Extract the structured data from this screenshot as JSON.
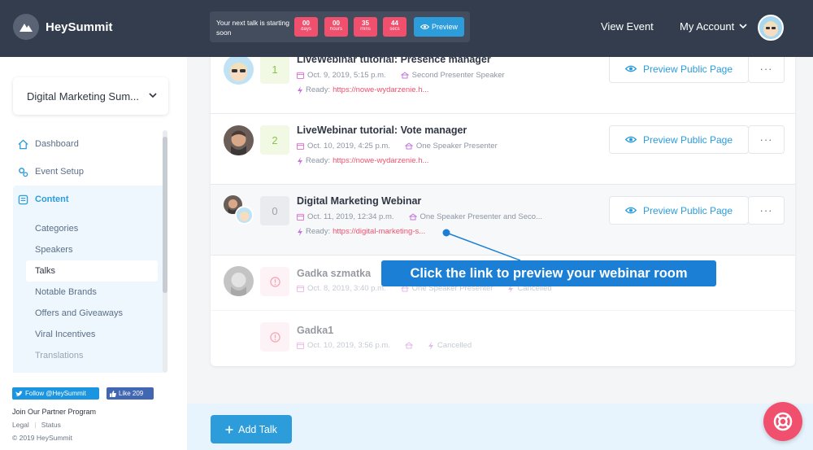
{
  "brand": {
    "name": "HeySummit"
  },
  "header": {
    "next_talk_label": "Your next talk is starting soon",
    "countdown": [
      {
        "value": "00",
        "unit": "days"
      },
      {
        "value": "00",
        "unit": "hours"
      },
      {
        "value": "35",
        "unit": "mins"
      },
      {
        "value": "44",
        "unit": "secs"
      }
    ],
    "preview_label": "Preview",
    "view_event": "View Event",
    "my_account": "My Account"
  },
  "sidebar": {
    "event_name": "Digital Marketing Sum...",
    "nav": [
      {
        "label": "Dashboard",
        "icon": "home-icon"
      },
      {
        "label": "Event Setup",
        "icon": "gears-icon"
      },
      {
        "label": "Content",
        "icon": "content-icon"
      }
    ],
    "subnav": [
      "Categories",
      "Speakers",
      "Talks",
      "Notable Brands",
      "Offers and Giveaways",
      "Viral Incentives",
      "Translations"
    ],
    "twitter_follow": "Follow @HeySummit",
    "facebook_like": "Like 209",
    "partner": "Join Our Partner Program",
    "legal": "Legal",
    "status": "Status",
    "copyright": "© 2019 HeySummit"
  },
  "talks": [
    {
      "num": "1",
      "title": "LiveWebinar tutorial: Presence manager",
      "date": "Oct. 9, 2019, 5:15 p.m.",
      "speakers": "Second Presenter Speaker",
      "status_label": "Ready:",
      "link": "https://nowe-wydarzenie.h..."
    },
    {
      "num": "2",
      "title": "LiveWebinar tutorial: Vote manager",
      "date": "Oct. 10, 2019, 4:25 p.m.",
      "speakers": "One Speaker Presenter",
      "status_label": "Ready:",
      "link": "https://nowe-wydarzenie.h..."
    },
    {
      "num": "0",
      "title": "Digital Marketing Webinar",
      "date": "Oct. 11, 2019, 12:34 p.m.",
      "speakers": "One Speaker Presenter and Seco...",
      "status_label": "Ready:",
      "link": "https://digital-marketing-s..."
    },
    {
      "title": "Gadka szmatka",
      "date": "Oct. 8, 2019, 3:40 p.m.",
      "speakers": "One Speaker Presenter",
      "status_label": "Cancelled"
    },
    {
      "title": "Gadka1",
      "date": "Oct. 10, 2019, 3:56 p.m.",
      "speakers": "",
      "status_label": "Cancelled"
    }
  ],
  "preview_public_page": "Preview Public Page",
  "callout": "Click the link to preview your webinar room",
  "add_talk": "Add Talk",
  "colors": {
    "accent": "#2d9cdb",
    "danger": "#f0506e",
    "topbar": "#333d4e",
    "callout": "#1c7fd6"
  }
}
